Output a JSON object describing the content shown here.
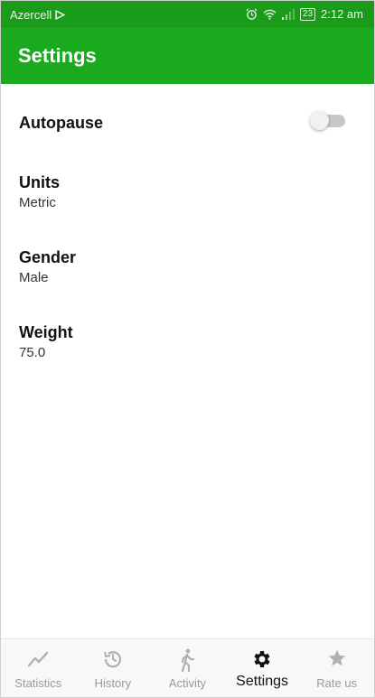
{
  "status_bar": {
    "carrier": "Azercell",
    "battery": "23",
    "time": "2:12 am"
  },
  "app_bar": {
    "title": "Settings"
  },
  "settings": {
    "autopause": {
      "label": "Autopause",
      "enabled": false
    },
    "units": {
      "label": "Units",
      "value": "Metric"
    },
    "gender": {
      "label": "Gender",
      "value": "Male"
    },
    "weight": {
      "label": "Weight",
      "value": "75.0"
    }
  },
  "bottom_nav": {
    "items": [
      {
        "label": "Statistics",
        "icon": "trend-line-icon"
      },
      {
        "label": "History",
        "icon": "history-icon"
      },
      {
        "label": "Activity",
        "icon": "walking-icon"
      },
      {
        "label": "Settings",
        "icon": "gear-icon",
        "active": true
      },
      {
        "label": "Rate us",
        "icon": "star-icon"
      }
    ]
  },
  "colors": {
    "status_bar": "#1a9c1a",
    "app_bar": "#1aaa1e",
    "active_nav": "#111111",
    "inactive_nav": "#9a9a9a"
  }
}
